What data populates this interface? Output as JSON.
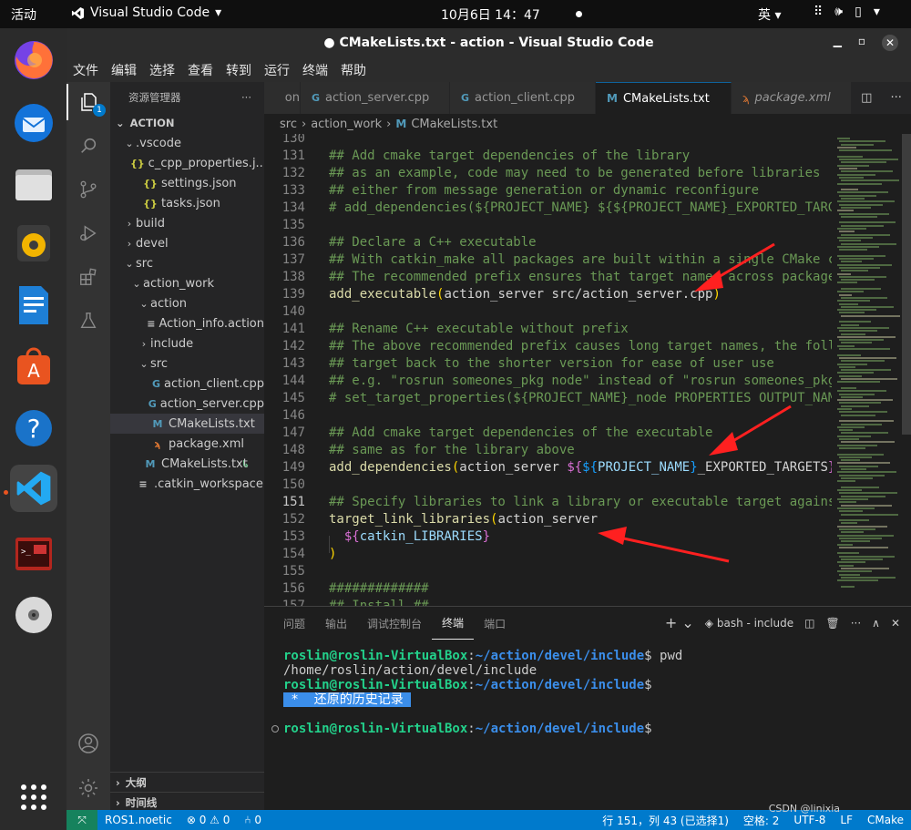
{
  "topbar": {
    "activities": "活动",
    "app_name": "Visual Studio Code",
    "clock": "10月6日  14：47",
    "ime": "英"
  },
  "window": {
    "title": "● CMakeLists.txt - action - Visual Studio Code"
  },
  "menu": [
    "文件",
    "编辑",
    "选择",
    "查看",
    "转到",
    "运行",
    "终端",
    "帮助"
  ],
  "explorer": {
    "title": "资源管理器",
    "more": "···",
    "root": "ACTION",
    "tree": [
      {
        "label": ".vscode",
        "chev": "⌄",
        "icon": "",
        "level": 1
      },
      {
        "label": "c_cpp_properties.j...",
        "chev": "",
        "icon": "{}",
        "level": 2
      },
      {
        "label": "settings.json",
        "chev": "",
        "icon": "{}",
        "level": 2
      },
      {
        "label": "tasks.json",
        "chev": "",
        "icon": "{}",
        "level": 2
      },
      {
        "label": "build",
        "chev": "›",
        "icon": "",
        "level": 1
      },
      {
        "label": "devel",
        "chev": "›",
        "icon": "",
        "level": 1
      },
      {
        "label": "src",
        "chev": "⌄",
        "icon": "",
        "level": 1
      },
      {
        "label": "action_work",
        "chev": "⌄",
        "icon": "",
        "level": 2
      },
      {
        "label": "action",
        "chev": "⌄",
        "icon": "",
        "level": 3
      },
      {
        "label": "Action_info.action",
        "chev": "",
        "icon": "≡",
        "level": 4
      },
      {
        "label": "include",
        "chev": "›",
        "icon": "",
        "level": 3
      },
      {
        "label": "src",
        "chev": "⌄",
        "icon": "",
        "level": 3
      },
      {
        "label": "action_client.cpp",
        "chev": "",
        "icon": "G",
        "level": 4
      },
      {
        "label": "action_server.cpp",
        "chev": "",
        "icon": "G",
        "level": 4
      },
      {
        "label": "CMakeLists.txt",
        "chev": "",
        "icon": "M",
        "level": 3,
        "selected": true
      },
      {
        "label": "package.xml",
        "chev": "",
        "icon": "ϡ",
        "level": 3
      },
      {
        "label": "CMakeLists.txt",
        "chev": "",
        "icon": "M",
        "level": 2,
        "status": "↳"
      },
      {
        "label": ".catkin_workspace",
        "chev": "",
        "icon": "≡",
        "level": 1
      }
    ],
    "outline": "大纲",
    "timeline": "时间线"
  },
  "tabs": [
    {
      "label": "on",
      "icon": ""
    },
    {
      "label": "action_server.cpp",
      "icon": "G"
    },
    {
      "label": "action_client.cpp",
      "icon": "G"
    },
    {
      "label": "CMakeLists.txt",
      "icon": "M",
      "active": true
    },
    {
      "label": "package.xml",
      "icon": "ϡ"
    }
  ],
  "breadcrumb": [
    "src",
    "action_work",
    "CMakeLists.txt"
  ],
  "code": [
    {
      "n": "130",
      "t": []
    },
    {
      "n": "131",
      "t": [
        [
          "c-cm",
          "## Add cmake target dependencies of the library"
        ]
      ]
    },
    {
      "n": "132",
      "t": [
        [
          "c-cm",
          "## as an example, code may need to be generated before libraries"
        ]
      ]
    },
    {
      "n": "133",
      "t": [
        [
          "c-cm",
          "## either from message generation or dynamic reconfigure"
        ]
      ]
    },
    {
      "n": "134",
      "t": [
        [
          "c-cm",
          "# add_dependencies(${PROJECT_NAME} ${${PROJECT_NAME}_EXPORTED_TARGETS}"
        ]
      ]
    },
    {
      "n": "135",
      "t": []
    },
    {
      "n": "136",
      "t": [
        [
          "c-cm",
          "## Declare a C++ executable"
        ]
      ]
    },
    {
      "n": "137",
      "t": [
        [
          "c-cm",
          "## With catkin_make all packages are built within a single CMake context"
        ]
      ]
    },
    {
      "n": "138",
      "t": [
        [
          "c-cm",
          "## The recommended prefix ensures that target names across packages"
        ]
      ]
    },
    {
      "n": "139",
      "t": [
        [
          "c-fn",
          "add_executable"
        ],
        [
          "c-br2",
          "("
        ],
        [
          "c-pl",
          "action_server src/action_server.cpp"
        ],
        [
          "c-br2",
          ")"
        ]
      ]
    },
    {
      "n": "140",
      "t": []
    },
    {
      "n": "141",
      "t": [
        [
          "c-cm",
          "## Rename C++ executable without prefix"
        ]
      ]
    },
    {
      "n": "142",
      "t": [
        [
          "c-cm",
          "## The above recommended prefix causes long target names, the following"
        ]
      ]
    },
    {
      "n": "143",
      "t": [
        [
          "c-cm",
          "## target back to the shorter version for ease of user use"
        ]
      ]
    },
    {
      "n": "144",
      "t": [
        [
          "c-cm",
          "## e.g. \"rosrun someones_pkg node\" instead of \"rosrun someones_pkg"
        ]
      ]
    },
    {
      "n": "145",
      "t": [
        [
          "c-cm",
          "# set_target_properties(${PROJECT_NAME}_node PROPERTIES OUTPUT_NAME"
        ]
      ]
    },
    {
      "n": "146",
      "t": []
    },
    {
      "n": "147",
      "t": [
        [
          "c-cm",
          "## Add cmake target dependencies of the executable"
        ]
      ]
    },
    {
      "n": "148",
      "t": [
        [
          "c-cm",
          "## same as for the library above"
        ]
      ]
    },
    {
      "n": "149",
      "t": [
        [
          "c-fn",
          "add_dependencies"
        ],
        [
          "c-br2",
          "("
        ],
        [
          "c-pl",
          "action_server "
        ],
        [
          "c-br",
          "${"
        ],
        [
          "c-br3",
          "${"
        ],
        [
          "c-var",
          "PROJECT_NAME"
        ],
        [
          "c-br3",
          "}"
        ],
        [
          "c-pl",
          "_EXPORTED_TARGETS"
        ],
        [
          "c-br",
          "}"
        ],
        [
          "c-br2",
          ")"
        ]
      ]
    },
    {
      "n": "150",
      "t": []
    },
    {
      "n": "151",
      "t": [
        [
          "c-cm",
          "## Specify libraries to link a library or executable target against"
        ]
      ],
      "current": true
    },
    {
      "n": "152",
      "t": [
        [
          "c-fn",
          "target_link_libraries"
        ],
        [
          "c-br2",
          "("
        ],
        [
          "c-pl",
          "action_server"
        ]
      ]
    },
    {
      "n": "153",
      "t": [
        [
          "c-pl",
          "  "
        ],
        [
          "c-br",
          "${"
        ],
        [
          "c-var",
          "catkin_LIBRARIES"
        ],
        [
          "c-br",
          "}"
        ]
      ]
    },
    {
      "n": "154",
      "t": [
        [
          "c-br2",
          ")"
        ]
      ]
    },
    {
      "n": "155",
      "t": []
    },
    {
      "n": "156",
      "t": [
        [
          "c-cm",
          "#############"
        ]
      ]
    },
    {
      "n": "157",
      "t": [
        [
          "c-cm",
          "## Install ##"
        ]
      ]
    }
  ],
  "panel": {
    "tabs": [
      "问题",
      "输出",
      "调试控制台",
      "终端",
      "端口"
    ],
    "active_tab": "终端",
    "plus": "+ ⌄",
    "terminal_name": "bash - include",
    "terminal": [
      {
        "user": "roslin@roslin-VirtualBox",
        "path": "~/action/devel/include",
        "cmd": " pwd"
      },
      {
        "plain": "/home/roslin/action/devel/include"
      },
      {
        "user": "roslin@roslin-VirtualBox",
        "path": "~/action/devel/include",
        "cmd": ""
      },
      {
        "highlight": " *  还原的历史记录 "
      },
      {
        "plain": ""
      },
      {
        "user": "roslin@roslin-VirtualBox",
        "path": "~/action/devel/include",
        "cmd": "",
        "dot": true
      }
    ]
  },
  "status": {
    "remote": "⤧",
    "ros": "ROS1.noetic",
    "problems": "⊗ 0 ⚠ 0",
    "ports": "⑃ 0",
    "cursor": "行 151，列 43 (已选择1)",
    "spaces": "空格: 2",
    "encoding": "UTF-8",
    "eol": "LF",
    "lang": "CMake",
    "watermark": "CSDN @linixia"
  },
  "colors": {
    "accent": "#007acc",
    "arrow": "#ff2020"
  }
}
